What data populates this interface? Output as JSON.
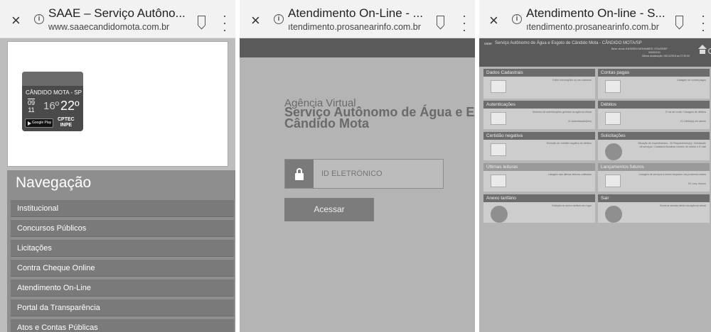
{
  "panels": [
    {
      "browser": {
        "close": "×",
        "title": "SAAE – Serviço Autôno...",
        "url": "www.saaecandidomota.com.br"
      },
      "weather": {
        "city": "CÂNDIDO MOTA - SP",
        "day": "09",
        "month": "11",
        "min": "16º",
        "max": "22º",
        "store": "Google Play",
        "provider_line1": "CPTEC",
        "provider_line2": "INPE"
      },
      "nav": {
        "heading": "Navegação",
        "items": [
          "Institucional",
          "Concursos Públicos",
          "Licitações",
          "Contra Cheque Online",
          "Atendimento On-Line",
          "Portal da Transparência",
          "Atos e Contas Públicas"
        ]
      }
    },
    {
      "browser": {
        "close": "×",
        "title": "Atendimento On-Line - ...",
        "url": "ıtendimento.prosanearinfo.com.br"
      },
      "login": {
        "agency": "Agência Virtual",
        "service_line1": "Serviço Autônomo de Água e Esg",
        "service_line2": "Cândido Mota",
        "id_placeholder": "ID ELETRÔNICO",
        "submit": "Acessar"
      }
    },
    {
      "browser": {
        "close": "×",
        "title": "Atendimento On-line - S...",
        "url": "ıtendimento.prosanearinfo.com.br"
      },
      "header": {
        "logo": "saae",
        "title": "Serviço Autônomo de Água e Esgoto de Cândido Mota - CÂNDIDO MOTA/SP",
        "welcome": "Bem vindo KASSEM MOHAMED YOUSSEF",
        "sub": "00000/100",
        "updated": "Última atualização: 06/11/2018 às 07:30:00"
      },
      "cards": [
        {
          "title": "Dados Cadastrais",
          "text": "Exibir informações do seu cadastro",
          "extra": ""
        },
        {
          "title": "Contas pagas",
          "text": "Listagem de contas pagas",
          "extra": ""
        },
        {
          "title": "Autenticações",
          "text": "Histórico de autenticações geradas na agência virtual",
          "extra": "01 Autenticação(ões)"
        },
        {
          "title": "Débitos",
          "text": "2ª via de conta / Listagem de débitos",
          "extra": "01 Débito(s) em aberto"
        },
        {
          "title": "Certidão negativa",
          "text": "Emissão de certidão negativa de débitos",
          "extra": ""
        },
        {
          "title": "Solicitações",
          "text": "Situação de requerimentos - 00 Requerimento(s) / Solicitação de serviços / Cadastrar/Atualizar número de celular e E-mail",
          "extra": ""
        },
        {
          "title": "Últimas leituras",
          "text": "Listagem das últimas leituras coletadas",
          "extra": ""
        },
        {
          "title": "Lançamentos futuros",
          "text": "Listagem de serviços a serem lançados nos próximos meses",
          "extra": "00 Lanç. futuros"
        },
        {
          "title": "Anexo tarifário",
          "text": "Exibição do anexo tarifário em vigor",
          "extra": ""
        },
        {
          "title": "Sair",
          "text": "Encerrar sessão dentro da agência virtual",
          "extra": ""
        }
      ]
    }
  ]
}
